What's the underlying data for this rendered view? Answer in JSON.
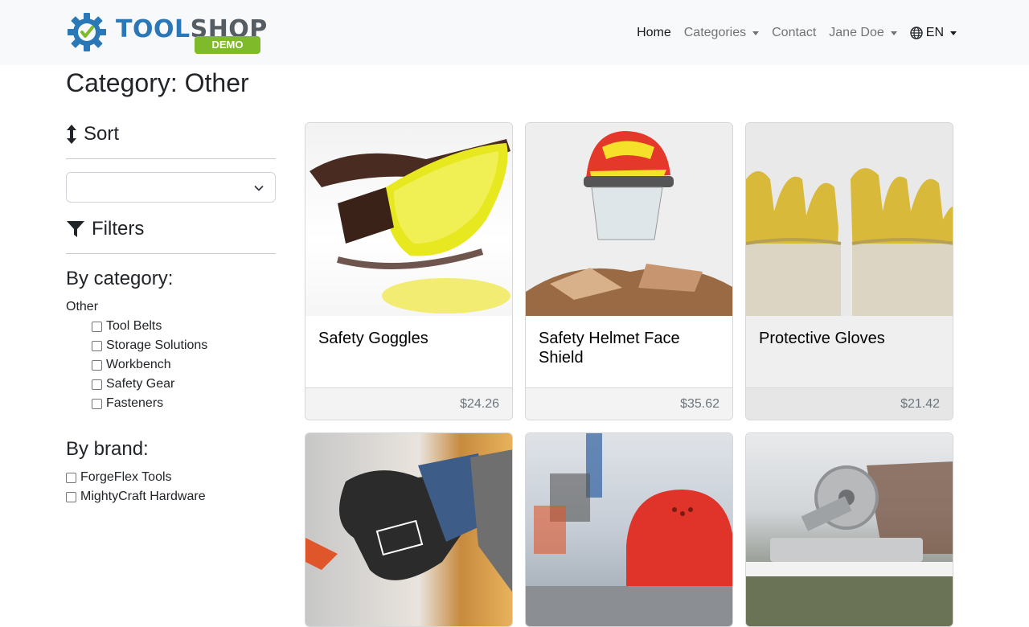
{
  "brand": {
    "name_part1": "TOOL",
    "name_part2": "SHOP",
    "badge": "DEMO"
  },
  "nav": {
    "home": "Home",
    "categories": "Categories",
    "contact": "Contact",
    "user": "Jane Doe",
    "language": "EN"
  },
  "page": {
    "title": "Category: Other"
  },
  "sidebar": {
    "sort_title": "Sort",
    "sort_value": "",
    "filters_title": "Filters",
    "by_category_title": "By category:",
    "category_root": "Other",
    "categories": [
      "Tool Belts",
      "Storage Solutions",
      "Workbench",
      "Safety Gear",
      "Fasteners"
    ],
    "by_brand_title": "By brand:",
    "brands": [
      "ForgeFlex Tools",
      "MightyCraft Hardware"
    ]
  },
  "products": [
    {
      "name": "Safety Goggles",
      "price": "$24.26",
      "image": "yellow-safety-goggles"
    },
    {
      "name": "Safety Helmet Face Shield",
      "price": "$35.62",
      "image": "red-helmet-face-shield"
    },
    {
      "name": "Protective Gloves",
      "price": "$21.42",
      "image": "yellow-work-gloves"
    },
    {
      "name": "",
      "price": "",
      "image": "black-work-glove"
    },
    {
      "name": "",
      "price": "",
      "image": "red-hard-hat"
    },
    {
      "name": "",
      "price": "",
      "image": "miter-saw"
    }
  ],
  "colors": {
    "logo_blue": "#2a78b8",
    "logo_gray": "#555d63",
    "demo_green": "#7fba2a",
    "navbar_bg": "#f8f9fa"
  }
}
